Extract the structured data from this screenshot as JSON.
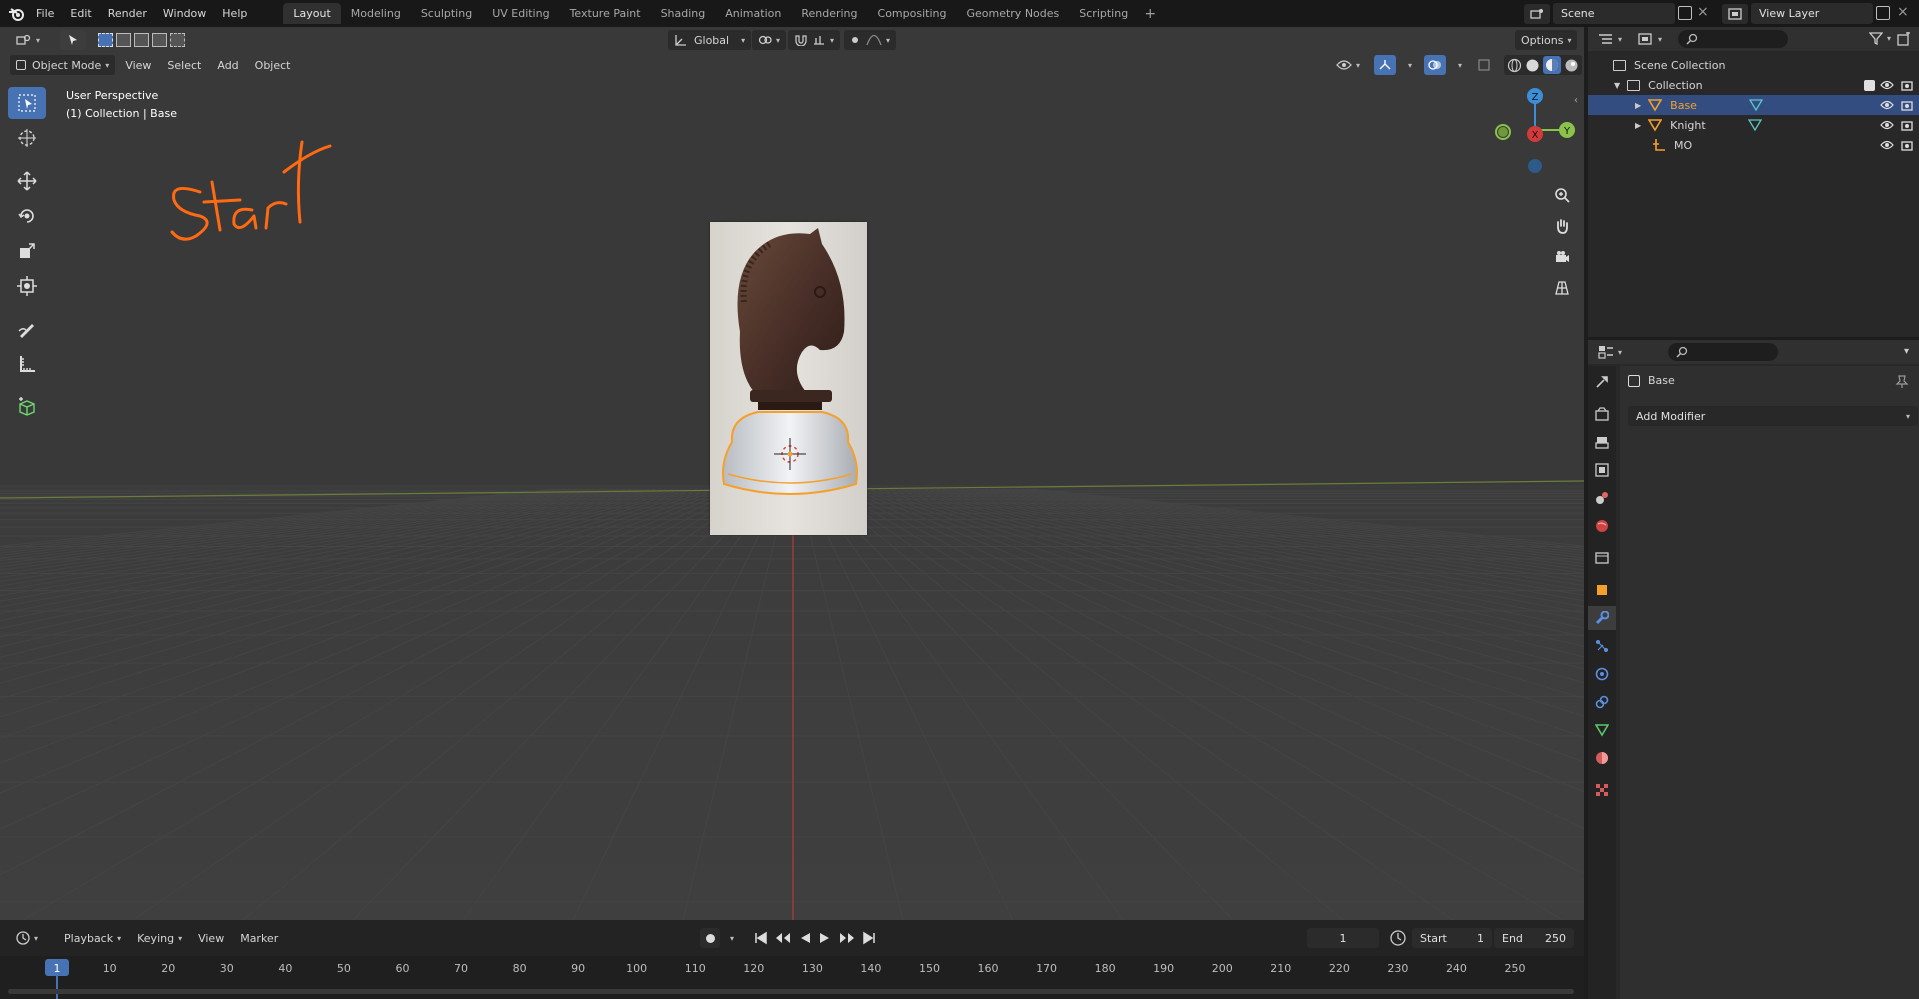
{
  "menu": {
    "items": [
      "File",
      "Edit",
      "Render",
      "Window",
      "Help"
    ]
  },
  "workspaces": {
    "tabs": [
      "Layout",
      "Modeling",
      "Sculpting",
      "UV Editing",
      "Texture Paint",
      "Shading",
      "Animation",
      "Rendering",
      "Compositing",
      "Geometry Nodes",
      "Scripting"
    ],
    "active": "Layout"
  },
  "scene": {
    "name": "Scene",
    "view_layer": "View Layer"
  },
  "viewport": {
    "mode": "Object Mode",
    "menus": [
      "View",
      "Select",
      "Add",
      "Object"
    ],
    "transform_orientation": "Global",
    "options_label": "Options",
    "overlay_line1": "User Perspective",
    "overlay_line2": "(1) Collection | Base",
    "annotation": "Start",
    "annotation_color": "#ff6a13",
    "gizmo": {
      "z": "Z",
      "y": "Y",
      "x": "X"
    }
  },
  "outliner": {
    "root": "Scene Collection",
    "collection": "Collection",
    "objects": [
      {
        "name": "Base",
        "selected": true
      },
      {
        "name": "Knight",
        "selected": false
      },
      {
        "name": "MO",
        "selected": false
      }
    ]
  },
  "properties": {
    "object_name": "Base",
    "add_modifier": "Add Modifier"
  },
  "timeline": {
    "menus": [
      "Playback",
      "Keying",
      "View",
      "Marker"
    ],
    "current_frame": "1",
    "start_label": "Start",
    "start_value": "1",
    "end_label": "End",
    "end_value": "250",
    "ruler": [
      "1",
      "10",
      "20",
      "30",
      "40",
      "50",
      "60",
      "70",
      "80",
      "90",
      "100",
      "110",
      "120",
      "130",
      "140",
      "150",
      "160",
      "170",
      "180",
      "190",
      "200",
      "210",
      "220",
      "230",
      "240",
      "250"
    ]
  },
  "colors": {
    "accent": "#4772b3",
    "selection_outline": "#f5a02a",
    "axis_x": "#d43a3a",
    "axis_y": "#8bc34a",
    "axis_z": "#3b8fd9"
  }
}
